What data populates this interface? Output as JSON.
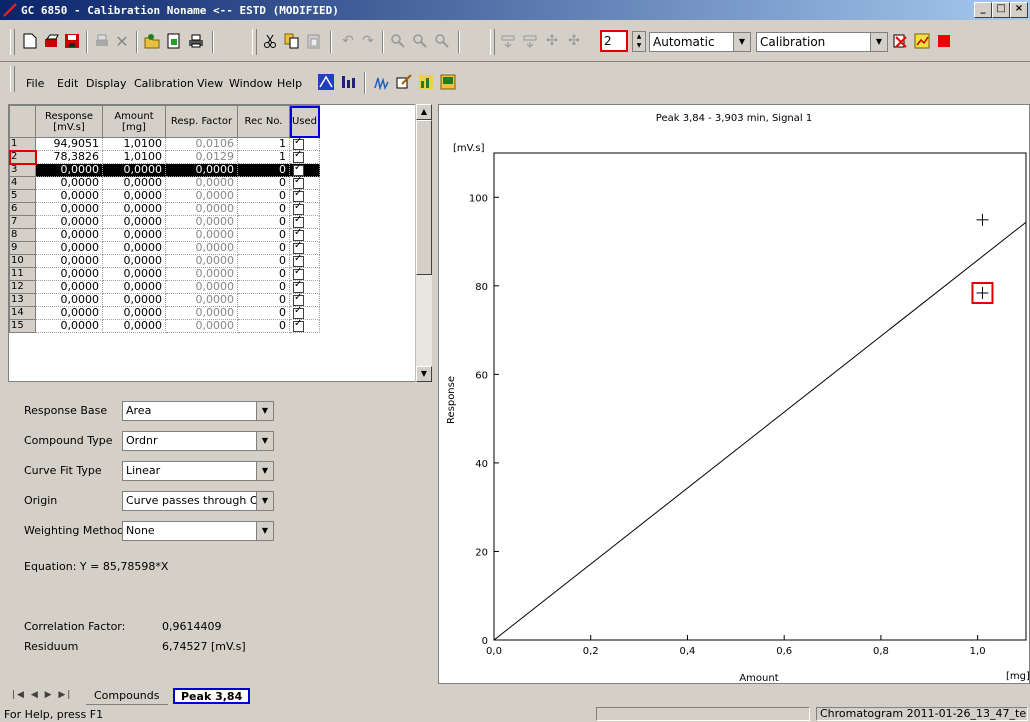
{
  "window": {
    "title": "GC 6850 - Calibration  Noname <-- ESTD  (MODIFIED)",
    "min": "_",
    "max": "□",
    "close": "×"
  },
  "toolbar": {
    "level_value": "2",
    "mode_value": "Automatic",
    "view_value": "Calibration"
  },
  "menu": [
    "File",
    "Edit",
    "Display",
    "Calibration",
    "View",
    "Window",
    "Help"
  ],
  "table": {
    "headers": [
      "Response\n[mV.s]",
      "Amount\n[mg]",
      "Resp. Factor",
      "Rec No.",
      "Used"
    ],
    "rows": [
      {
        "n": "1",
        "response": "94,9051",
        "amount": "1,0100",
        "factor": "0,0106",
        "rec": "1"
      },
      {
        "n": "2",
        "response": "78,3826",
        "amount": "1,0100",
        "factor": "0,0129",
        "rec": "1"
      },
      {
        "n": "3",
        "response": "0,0000",
        "amount": "0,0000",
        "factor": "0,0000",
        "rec": "0"
      },
      {
        "n": "4",
        "response": "0,0000",
        "amount": "0,0000",
        "factor": "0,0000",
        "rec": "0"
      },
      {
        "n": "5",
        "response": "0,0000",
        "amount": "0,0000",
        "factor": "0,0000",
        "rec": "0"
      },
      {
        "n": "6",
        "response": "0,0000",
        "amount": "0,0000",
        "factor": "0,0000",
        "rec": "0"
      },
      {
        "n": "7",
        "response": "0,0000",
        "amount": "0,0000",
        "factor": "0,0000",
        "rec": "0"
      },
      {
        "n": "8",
        "response": "0,0000",
        "amount": "0,0000",
        "factor": "0,0000",
        "rec": "0"
      },
      {
        "n": "9",
        "response": "0,0000",
        "amount": "0,0000",
        "factor": "0,0000",
        "rec": "0"
      },
      {
        "n": "10",
        "response": "0,0000",
        "amount": "0,0000",
        "factor": "0,0000",
        "rec": "0"
      },
      {
        "n": "11",
        "response": "0,0000",
        "amount": "0,0000",
        "factor": "0,0000",
        "rec": "0"
      },
      {
        "n": "12",
        "response": "0,0000",
        "amount": "0,0000",
        "factor": "0,0000",
        "rec": "0"
      },
      {
        "n": "13",
        "response": "0,0000",
        "amount": "0,0000",
        "factor": "0,0000",
        "rec": "0"
      },
      {
        "n": "14",
        "response": "0,0000",
        "amount": "0,0000",
        "factor": "0,0000",
        "rec": "0"
      },
      {
        "n": "15",
        "response": "0,0000",
        "amount": "0,0000",
        "factor": "0,0000",
        "rec": "0"
      }
    ]
  },
  "props": {
    "response_base_label": "Response Base",
    "response_base_value": "Area",
    "compound_type_label": "Compound Type",
    "compound_type_value": "Ordnr",
    "curve_fit_label": "Curve Fit Type",
    "curve_fit_value": "Linear",
    "origin_label": "Origin",
    "origin_value": "Curve passes through Ori",
    "weighting_label": "Weighting Method",
    "weighting_value": "None",
    "equation": "Equation:  Y = 85,78598*X",
    "correlation_label": "Correlation Factor:",
    "correlation_value": "0,9614409",
    "residuum_label": "Residuum",
    "residuum_value": "6,74527 [mV.s]"
  },
  "tabs": {
    "compounds": "Compounds",
    "peak": "Peak 3,84"
  },
  "status": {
    "help": "For Help, press F1",
    "chromatogram": "Chromatogram  2011-01-26_13_47_te"
  },
  "chart_data": {
    "type": "scatter",
    "title": "Peak 3,84 - 3,903 min, Signal 1",
    "xlabel": "Amount",
    "ylabel": "Response",
    "x_unit": "[mg]",
    "y_unit": "[mV.s]",
    "xlim": [
      0,
      1.1
    ],
    "ylim": [
      0,
      110
    ],
    "x_ticks": [
      "0,0",
      "0,2",
      "0,4",
      "0,6",
      "0,8",
      "1,0"
    ],
    "y_ticks": [
      "0",
      "20",
      "40",
      "60",
      "80",
      "100"
    ],
    "points": [
      {
        "x": 1.01,
        "y": 94.9051
      },
      {
        "x": 1.01,
        "y": 78.3826
      }
    ],
    "fit_line": {
      "slope": 85.78598,
      "intercept": 0
    }
  }
}
